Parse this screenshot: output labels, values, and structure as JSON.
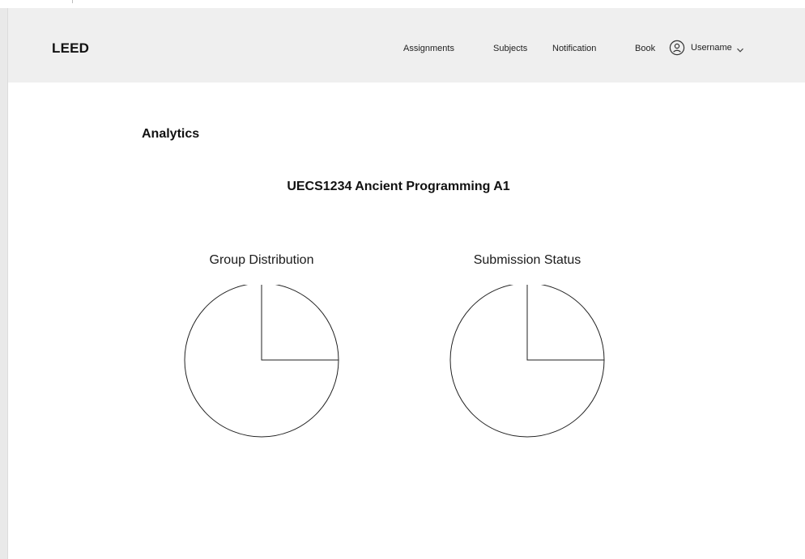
{
  "header": {
    "brand": "LEED",
    "nav": [
      {
        "label": "Assignments"
      },
      {
        "label": "Subjects"
      },
      {
        "label": "Notification"
      },
      {
        "label": "Book"
      }
    ],
    "user": {
      "name": "Username",
      "icon": "user-circle-icon",
      "dropdown_icon": "chevron-down-icon"
    }
  },
  "main": {
    "heading": "Analytics",
    "assignment_title": "UECS1234 Ancient Programming A1",
    "charts": [
      {
        "title": "Group Distribution"
      },
      {
        "title": "Submission Status"
      }
    ]
  },
  "chart_data": [
    {
      "type": "pie",
      "title": "Group Distribution",
      "values": [
        25,
        75
      ]
    },
    {
      "type": "pie",
      "title": "Submission Status",
      "values": [
        25,
        75
      ]
    }
  ],
  "colors": {
    "header_bg": "#efefef",
    "page_bg": "#ffffff",
    "text": "#111111",
    "pie_stroke": "#222222",
    "pie_fill": "#ffffff"
  }
}
